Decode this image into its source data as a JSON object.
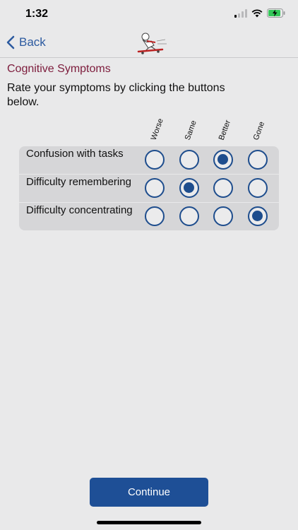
{
  "status": {
    "time": "1:32"
  },
  "nav": {
    "back_label": "Back"
  },
  "title": "Cognitive Symptoms",
  "instructions": "Rate your symptoms by clicking the buttons below.",
  "columns": [
    "Worse",
    "Same",
    "Better",
    "Gone"
  ],
  "rows": [
    {
      "label": "Confusion with tasks",
      "selected": "Better"
    },
    {
      "label": "Difficulty remembering",
      "selected": "Same"
    },
    {
      "label": "Difficulty concentrating",
      "selected": "Gone"
    }
  ],
  "continue_label": "Continue",
  "colors": {
    "accent": "#1e4d8d",
    "title": "#7d1c3c",
    "button": "#1e4f96",
    "battery": "#34c759"
  }
}
